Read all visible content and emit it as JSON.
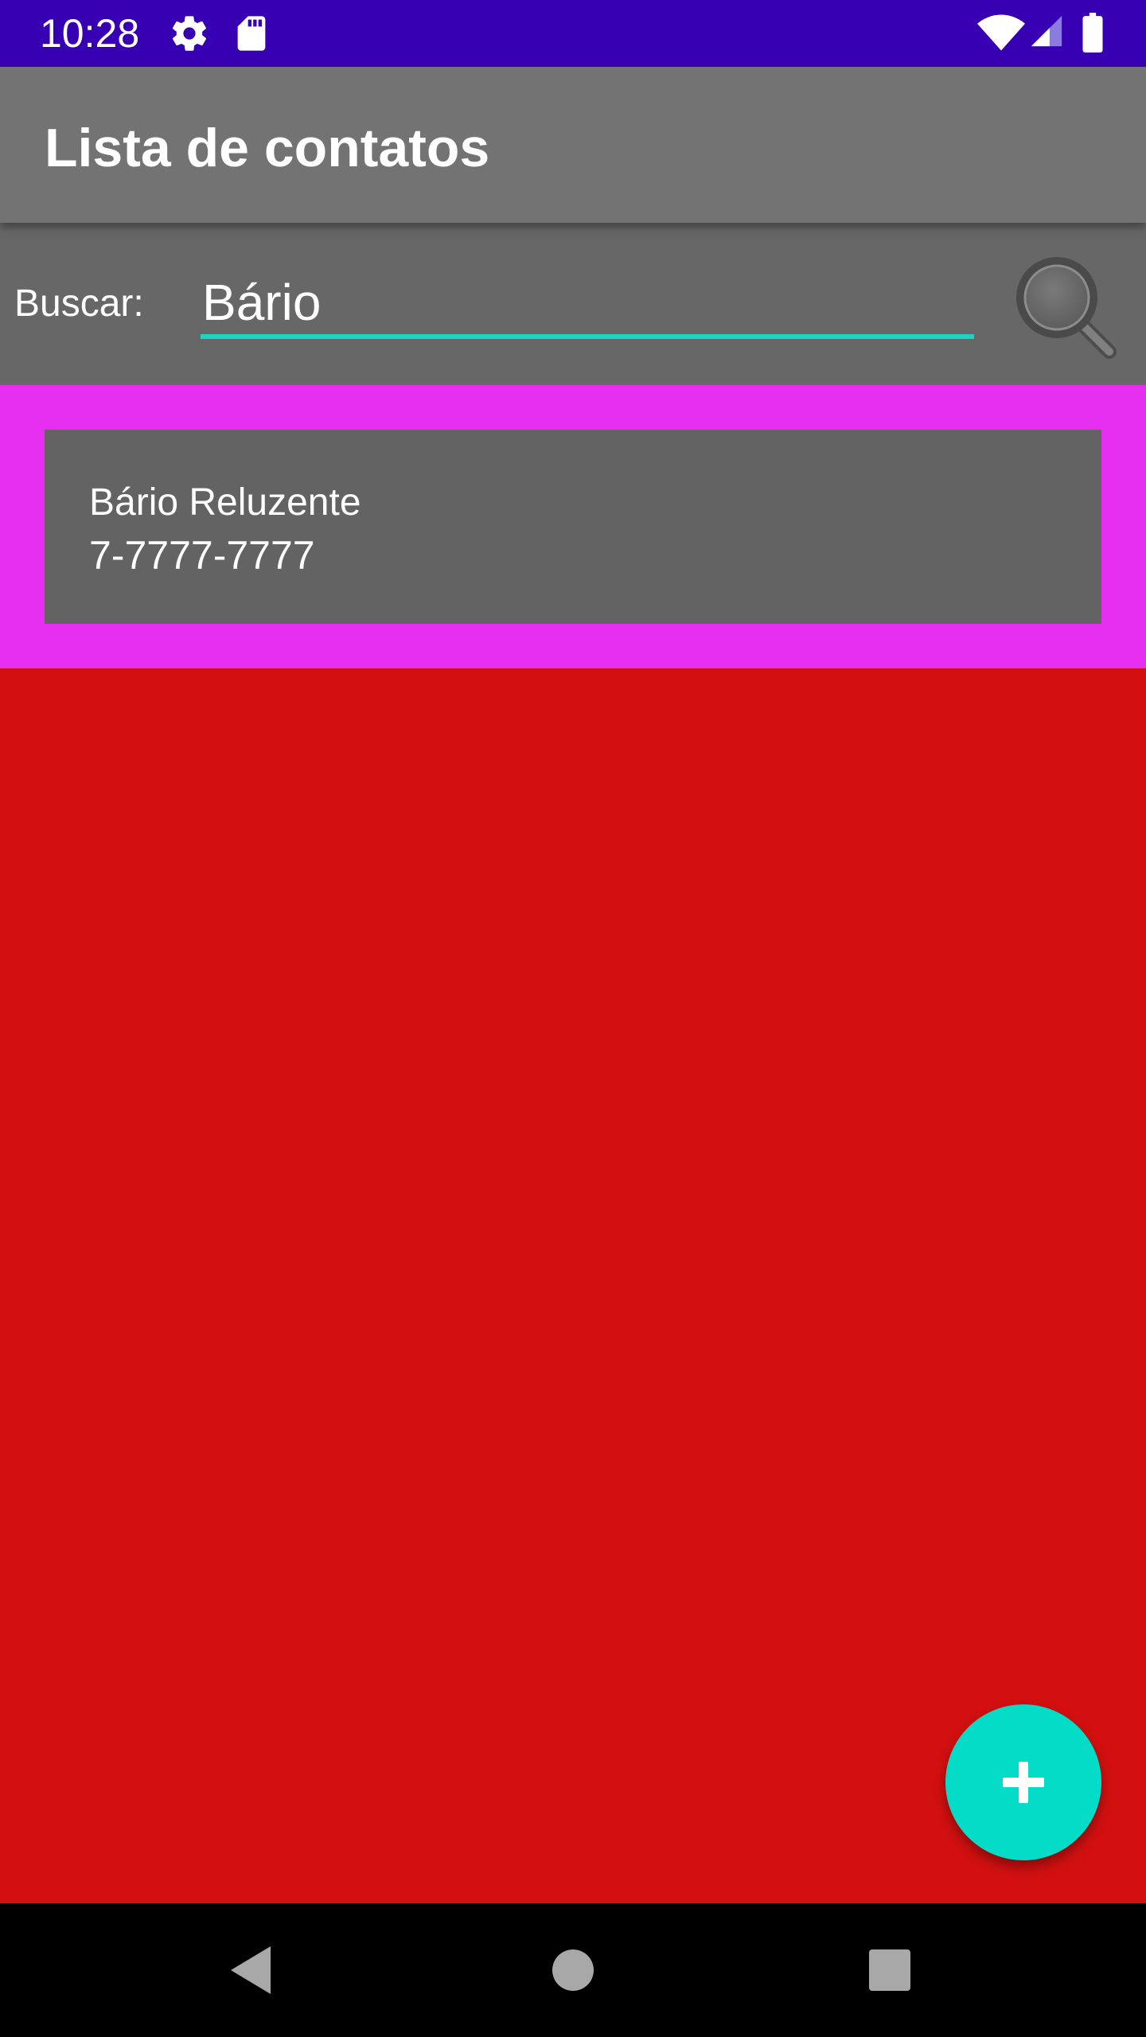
{
  "status_bar": {
    "time": "10:28",
    "icons": [
      "settings-icon",
      "sd-card-icon",
      "wifi-icon",
      "signal-icon",
      "battery-icon"
    ]
  },
  "app_bar": {
    "title": "Lista de contatos"
  },
  "search": {
    "label": "Buscar:",
    "value": "Bário",
    "button_icon": "magnifier-icon"
  },
  "contacts": [
    {
      "name": "Bário Reluzente",
      "phone": "7-7777-7777"
    }
  ],
  "fab": {
    "icon": "plus-icon"
  },
  "nav_bar": {
    "buttons": [
      "back-icon",
      "home-icon",
      "recents-icon"
    ]
  },
  "colors": {
    "status_bar": "#3700b3",
    "app_bar": "#737373",
    "search_row": "#676767",
    "accent": "#1ad4c4",
    "fab": "#05dcc8",
    "list_background": "#e52ef0",
    "card": "#636363",
    "page_background": "#d21010",
    "nav_bar": "#000000"
  }
}
